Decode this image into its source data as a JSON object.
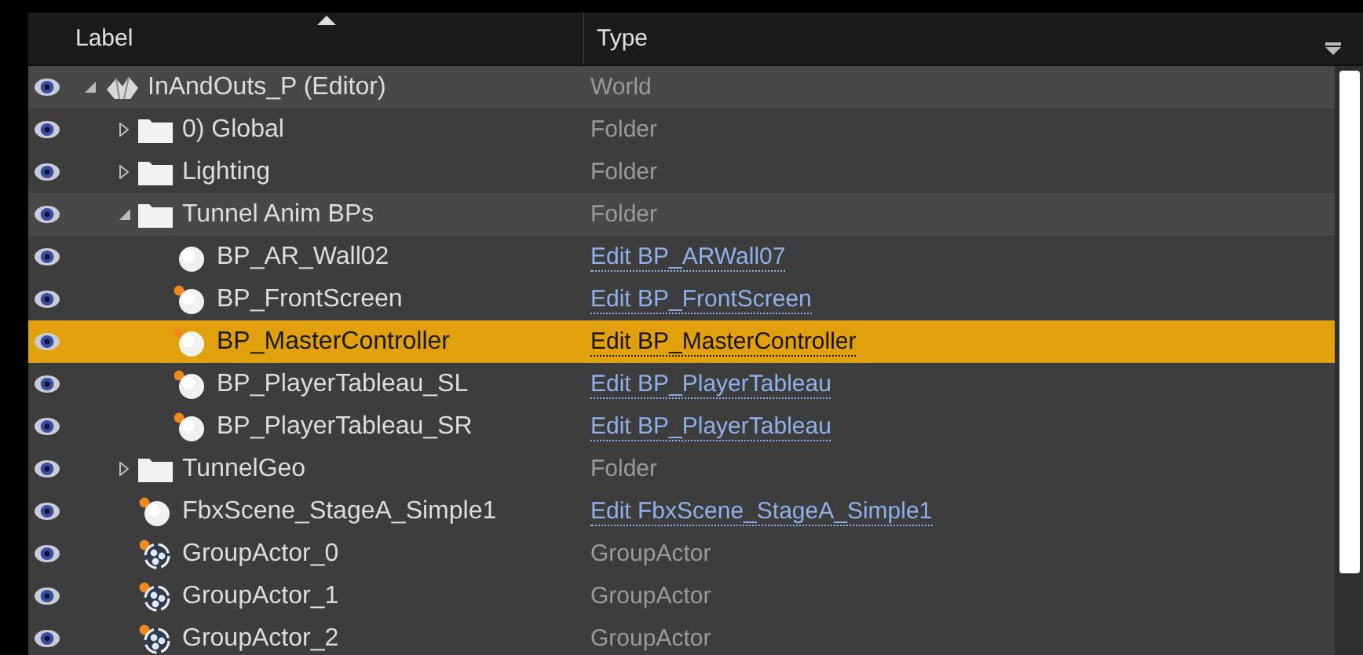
{
  "columns": [
    {
      "label": "Label",
      "sorted": true
    },
    {
      "label": "Type",
      "sorted": false
    }
  ],
  "tree": [
    {
      "label": "InAndOuts_P (Editor)",
      "kind": "world",
      "type": "World",
      "linked": false,
      "expanded": true,
      "selected": false,
      "children": [
        {
          "label": "0) Global",
          "kind": "folder",
          "type": "Folder",
          "linked": false,
          "expanded": false,
          "selected": false
        },
        {
          "label": "Lighting",
          "kind": "folder",
          "type": "Folder",
          "linked": false,
          "expanded": false,
          "selected": false
        },
        {
          "label": "Tunnel Anim BPs",
          "kind": "folder",
          "type": "Folder",
          "linked": false,
          "expanded": true,
          "selected": false,
          "children": [
            {
              "label": "BP_AR_Wall02",
              "kind": "actor",
              "modified": false,
              "type": "Edit BP_ARWall07",
              "linked": true,
              "selected": false
            },
            {
              "label": "BP_FrontScreen",
              "kind": "actor",
              "modified": true,
              "type": "Edit BP_FrontScreen",
              "linked": true,
              "selected": false
            },
            {
              "label": "BP_MasterController",
              "kind": "actor",
              "modified": true,
              "type": "Edit BP_MasterController",
              "linked": true,
              "selected": true
            },
            {
              "label": "BP_PlayerTableau_SL",
              "kind": "actor",
              "modified": true,
              "type": "Edit BP_PlayerTableau",
              "linked": true,
              "selected": false
            },
            {
              "label": "BP_PlayerTableau_SR",
              "kind": "actor",
              "modified": true,
              "type": "Edit BP_PlayerTableau",
              "linked": true,
              "selected": false
            }
          ]
        },
        {
          "label": "TunnelGeo",
          "kind": "folder",
          "type": "Folder",
          "linked": false,
          "expanded": false,
          "selected": false
        },
        {
          "label": "FbxScene_StageA_Simple1",
          "kind": "actor",
          "modified": true,
          "type": "Edit FbxScene_StageA_Simple1",
          "linked": true,
          "selected": false
        },
        {
          "label": "GroupActor_0",
          "kind": "group",
          "modified": true,
          "type": "GroupActor",
          "linked": false,
          "selected": false
        },
        {
          "label": "GroupActor_1",
          "kind": "group",
          "modified": true,
          "type": "GroupActor",
          "linked": false,
          "selected": false
        },
        {
          "label": "GroupActor_2",
          "kind": "group",
          "modified": true,
          "type": "GroupActor",
          "linked": false,
          "selected": false
        }
      ]
    }
  ]
}
